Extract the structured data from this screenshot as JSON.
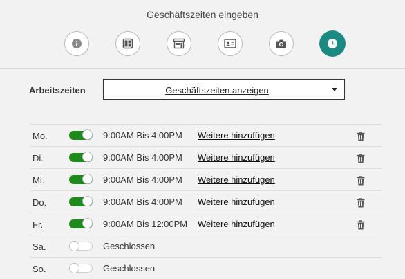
{
  "header": {
    "title": "Geschäftszeiten eingeben",
    "steps": [
      {
        "icon": "info-icon",
        "active": false
      },
      {
        "icon": "layout-icon",
        "active": false
      },
      {
        "icon": "storefront-icon",
        "active": false
      },
      {
        "icon": "id-card-icon",
        "active": false
      },
      {
        "icon": "camera-icon",
        "active": false
      },
      {
        "icon": "clock-icon",
        "active": true
      }
    ],
    "accent_color": "#1a8a82"
  },
  "hours": {
    "label": "Arbeitszeiten",
    "selected": "Geschäftszeiten anzeigen"
  },
  "days": [
    {
      "name": "Mo.",
      "enabled": true,
      "time": "9:00AM Bis 4:00PM",
      "add_label": "Weitere hinzufügen"
    },
    {
      "name": "Di.",
      "enabled": true,
      "time": "9:00AM Bis 4:00PM",
      "add_label": "Weitere hinzufügen"
    },
    {
      "name": "Mi.",
      "enabled": true,
      "time": "9:00AM Bis 4:00PM",
      "add_label": "Weitere hinzufügen"
    },
    {
      "name": "Do.",
      "enabled": true,
      "time": "9:00AM Bis 4:00PM",
      "add_label": "Weitere hinzufügen"
    },
    {
      "name": "Fr.",
      "enabled": true,
      "time": "9:00AM Bis 12:00PM",
      "add_label": "Weitere hinzufügen"
    },
    {
      "name": "Sa.",
      "enabled": false,
      "time": "Geschlossen"
    },
    {
      "name": "So.",
      "enabled": false,
      "time": "Geschlossen"
    }
  ],
  "toggle_on_color": "#1e8a1e"
}
